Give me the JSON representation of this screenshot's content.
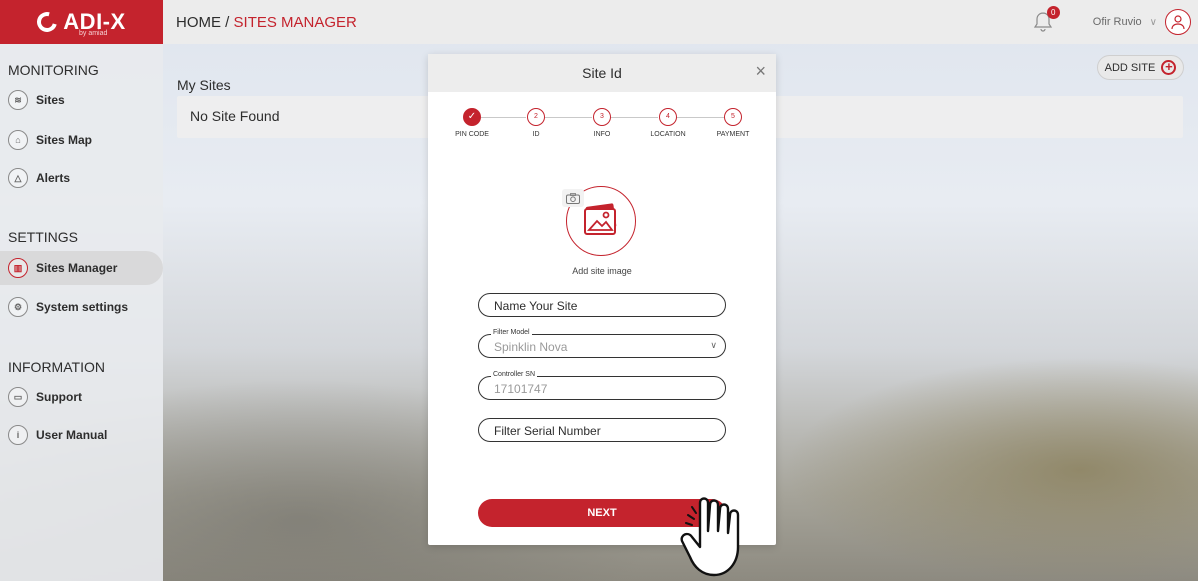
{
  "app": {
    "logo_text": "ADI-X",
    "logo_sub": "by amiad",
    "brand_color": "#c4232d"
  },
  "breadcrumb": {
    "home": "HOME / ",
    "current": "SITES MANAGER"
  },
  "header": {
    "notification_count": "0",
    "user_name": "Ofir Ruvio"
  },
  "sidebar": {
    "monitoring_title": "MONITORING",
    "settings_title": "SETTINGS",
    "information_title": "INFORMATION",
    "items": [
      {
        "label": "Sites",
        "icon": "layers-icon"
      },
      {
        "label": "Sites Map",
        "icon": "map-icon"
      },
      {
        "label": "Alerts",
        "icon": "alert-icon"
      },
      {
        "label": "Sites Manager",
        "icon": "sites-manager-icon",
        "active": true
      },
      {
        "label": "System settings",
        "icon": "gear-icon"
      },
      {
        "label": "Support",
        "icon": "chat-icon"
      },
      {
        "label": "User Manual",
        "icon": "manual-icon"
      }
    ]
  },
  "main": {
    "section_title": "My Sites",
    "empty_text": "No Site Found",
    "add_site_label": "ADD SITE"
  },
  "modal": {
    "title": "Site Id",
    "close_glyph": "×",
    "steps": [
      {
        "number": "✓",
        "label": "PIN CODE",
        "done": true
      },
      {
        "number": "2",
        "label": "ID"
      },
      {
        "number": "3",
        "label": "INFO"
      },
      {
        "number": "4",
        "label": "LOCATION"
      },
      {
        "number": "5",
        "label": "PAYMENT"
      }
    ],
    "add_image_label": "Add site image",
    "fields": {
      "site_name_placeholder": "Name Your Site",
      "filter_model_legend": "Filter Model",
      "filter_model_value": "Spinklin Nova",
      "controller_sn_legend": "Controller SN",
      "controller_sn_value": "17101747",
      "filter_serial_placeholder": "Filter Serial Number"
    },
    "next_label": "NEXT"
  }
}
